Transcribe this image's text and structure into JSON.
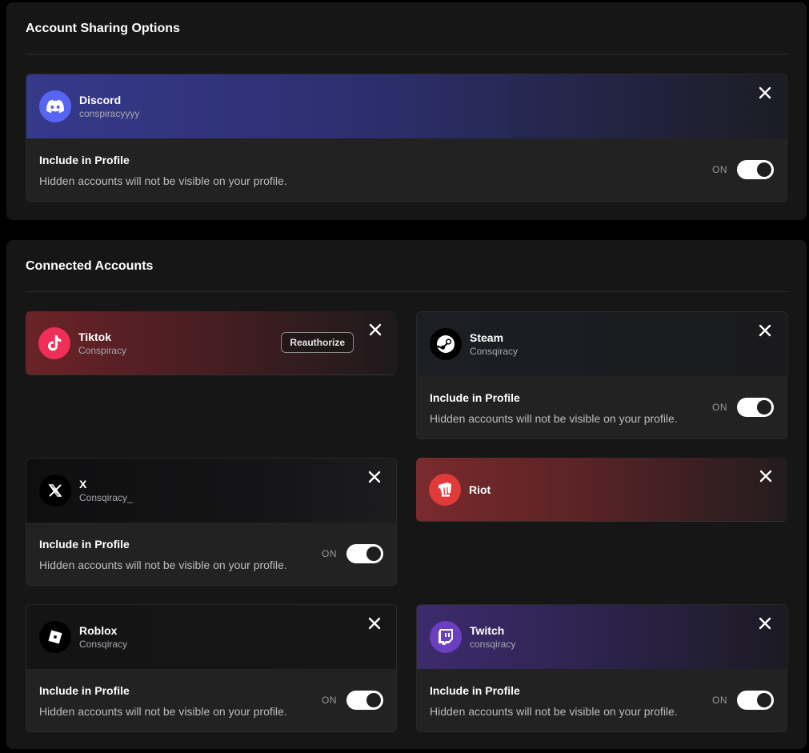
{
  "sharing": {
    "title": "Account Sharing Options",
    "discord": {
      "name": "Discord",
      "username": "conspiracyyyy",
      "include_title": "Include in Profile",
      "include_desc": "Hidden accounts will not be visible on your profile.",
      "toggle_label": "ON",
      "toggle_on": true
    }
  },
  "connected": {
    "title": "Connected Accounts",
    "tiktok": {
      "name": "Tiktok",
      "username": "Conspiracy",
      "reauthorize_label": "Reauthorize"
    },
    "steam": {
      "name": "Steam",
      "username": "Consqiracy",
      "include_title": "Include in Profile",
      "include_desc": "Hidden accounts will not be visible on your profile.",
      "toggle_label": "ON",
      "toggle_on": true
    },
    "x": {
      "name": "X",
      "username": "Consqiracy_",
      "include_title": "Include in Profile",
      "include_desc": "Hidden accounts will not be visible on your profile.",
      "toggle_label": "ON",
      "toggle_on": true
    },
    "riot": {
      "name": "Riot"
    },
    "roblox": {
      "name": "Roblox",
      "username": "Consqiracy",
      "include_title": "Include in Profile",
      "include_desc": "Hidden accounts will not be visible on your profile.",
      "toggle_label": "ON",
      "toggle_on": true
    },
    "twitch": {
      "name": "Twitch",
      "username": "consqiracy",
      "include_title": "Include in Profile",
      "include_desc": "Hidden accounts will not be visible on your profile.",
      "toggle_label": "ON",
      "toggle_on": true
    }
  },
  "colors": {
    "background": "#000000",
    "panel": "#161616",
    "card_body": "#222222",
    "discord_brand": "#5865f2",
    "tiktok_brand": "#f02e5a",
    "riot_brand": "#e23a3a",
    "twitch_brand": "#6a3fc0",
    "toggle_on": "#ffffff"
  },
  "icons": {
    "discord": "discord-icon",
    "tiktok": "tiktok-icon",
    "steam": "steam-icon",
    "x": "x-logo-icon",
    "riot": "riot-icon",
    "roblox": "roblox-icon",
    "twitch": "twitch-icon",
    "close": "close-icon"
  }
}
